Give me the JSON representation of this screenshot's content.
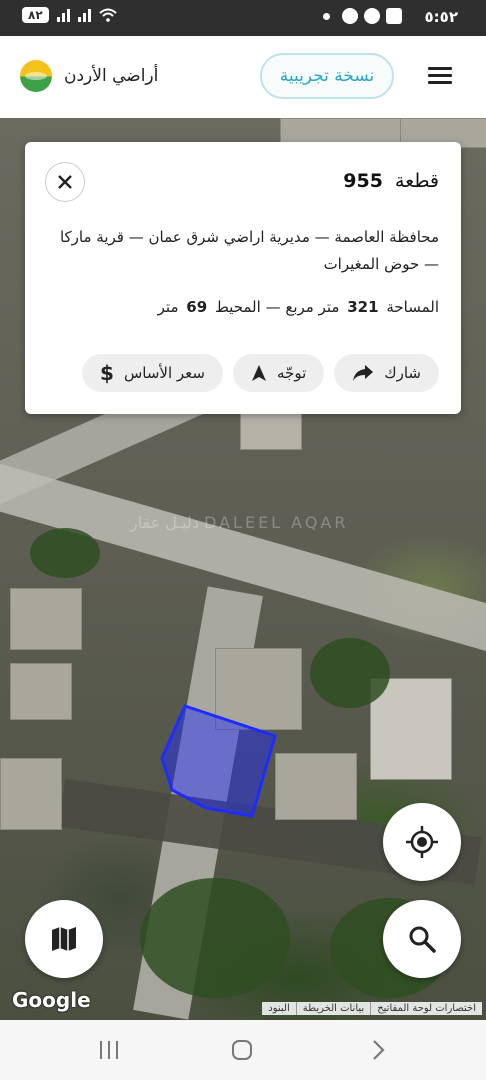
{
  "status_bar": {
    "battery": "٨٢",
    "time": "٥:٥٢",
    "icons": [
      "signal-icon",
      "signal-icon",
      "wifi-icon",
      "dot-icon",
      "whatsapp-icon",
      "facebook-icon",
      "screenshot-icon"
    ]
  },
  "header": {
    "brand_name": "أراضي الأردن",
    "trial_label": "نسخة تجريبية",
    "menu_icon": "hamburger-menu-icon"
  },
  "card": {
    "parcel_label": "قطعة",
    "parcel_number": "955",
    "address": "محافظة العاصمة — مديرية اراضي شرق عمان — قرية ماركا — حوض المغيرات",
    "area_label": "المساحة",
    "area_value": "321",
    "area_unit": "متر مربع",
    "separator": "—",
    "perimeter_label": "المحيط",
    "perimeter_value": "69",
    "perimeter_unit": "متر",
    "actions": {
      "share": "شارك",
      "navigate": "توجّه",
      "base_price": "سعر الأساس",
      "base_price_symbol": "$"
    }
  },
  "map": {
    "watermark": "دليـل عقار  DALEEL AQAR",
    "google_logo": "Google",
    "attribution": [
      "البنود",
      "بيانات الخريطة",
      "اختصارات لوحة المفاتيح"
    ],
    "parcel_color": "#1f2bff"
  },
  "fabs": {
    "locate": "my-location-icon",
    "layers": "map-layers-icon",
    "search": "search-icon"
  },
  "navbar": [
    "recent-apps-icon",
    "home-icon",
    "back-icon"
  ]
}
